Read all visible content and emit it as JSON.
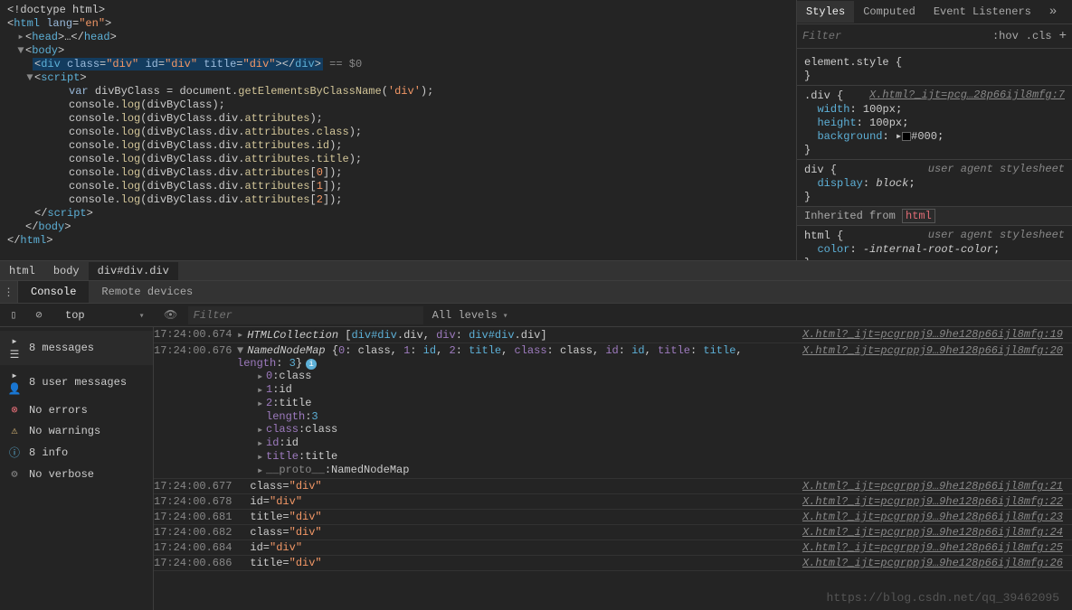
{
  "elements": {
    "doctype": "<!doctype html>",
    "html_open": "html",
    "lang_attr": "lang",
    "lang_val": "\"en\"",
    "head": "head",
    "body": "body",
    "div_line": {
      "tag": "div",
      "class_attr": "class",
      "class_val": "\"div\"",
      "id_attr": "id",
      "id_val": "\"div\"",
      "title_attr": "title",
      "title_val": "\"div\"",
      "eq": "== $0"
    },
    "script": "script",
    "code": [
      "var divByClass = document.getElementsByClassName('div');",
      "console.log(divByClass);",
      "console.log(divByClass.div.attributes);",
      "console.log(divByClass.div.attributes.class);",
      "console.log(divByClass.div.attributes.id);",
      "console.log(divByClass.div.attributes.title);",
      "console.log(divByClass.div.attributes[0]);",
      "console.log(divByClass.div.attributes[1]);",
      "console.log(divByClass.div.attributes[2]);"
    ]
  },
  "styles": {
    "tabs": {
      "styles": "Styles",
      "computed": "Computed",
      "listeners": "Event Listeners"
    },
    "filter_placeholder": "Filter",
    "hov": ":hov",
    "cls": ".cls",
    "element_style": "element.style {",
    "div_sel": ".div {",
    "div_src": "X.html?_ijt=pcg…28p66ijl8mfg:7",
    "width": {
      "name": "width",
      "val": "100px"
    },
    "height": {
      "name": "height",
      "val": "100px"
    },
    "background": {
      "name": "background",
      "val": "#000"
    },
    "div_ua_sel": "div {",
    "ua": "user agent stylesheet",
    "display": {
      "name": "display",
      "val": "block"
    },
    "inherited": "Inherited from",
    "inherited_tag": "html",
    "html_sel": "html {",
    "color": {
      "name": "color",
      "val": "-internal-root-color"
    }
  },
  "breadcrumb": {
    "html": "html",
    "body": "body",
    "current": "div#div.div"
  },
  "console_tabs": {
    "console": "Console",
    "remote": "Remote devices"
  },
  "console_toolbar": {
    "context": "top",
    "filter_placeholder": "Filter",
    "levels": "All levels"
  },
  "sidebar": {
    "messages": "8 messages",
    "user": "8 user messages",
    "errors": "No errors",
    "warnings": "No warnings",
    "info": "8 info",
    "verbose": "No verbose"
  },
  "logs": [
    {
      "ts": "17:24:00.674",
      "type": "htmlcollection",
      "src": "X.html?_ijt=pcgrppj9…9he128p66ijl8mfg:19"
    },
    {
      "ts": "17:24:00.676",
      "type": "namednodemap",
      "src": "X.html?_ijt=pcgrppj9…9he128p66ijl8mfg:20",
      "items": [
        {
          "k": "0",
          "v": "class"
        },
        {
          "k": "1",
          "v": "id"
        },
        {
          "k": "2",
          "v": "title"
        },
        {
          "k": "length",
          "v": "3"
        },
        {
          "k": "class",
          "v": "class"
        },
        {
          "k": "id",
          "v": "id"
        },
        {
          "k": "title",
          "v": "title"
        },
        {
          "proto": "__proto__",
          "v": "NamedNodeMap"
        }
      ]
    },
    {
      "ts": "17:24:00.677",
      "attr": "class=\"div\"",
      "src": "X.html?_ijt=pcgrppj9…9he128p66ijl8mfg:21"
    },
    {
      "ts": "17:24:00.678",
      "attr": "id=\"div\"",
      "src": "X.html?_ijt=pcgrppj9…9he128p66ijl8mfg:22"
    },
    {
      "ts": "17:24:00.681",
      "attr": "title=\"div\"",
      "src": "X.html?_ijt=pcgrppj9…9he128p66ijl8mfg:23"
    },
    {
      "ts": "17:24:00.682",
      "attr": "class=\"div\"",
      "src": "X.html?_ijt=pcgrppj9…9he128p66ijl8mfg:24"
    },
    {
      "ts": "17:24:00.684",
      "attr": "id=\"div\"",
      "src": "X.html?_ijt=pcgrppj9…9he128p66ijl8mfg:25"
    },
    {
      "ts": "17:24:00.686",
      "attr": "title=\"div\"",
      "src": "X.html?_ijt=pcgrppj9…9he128p66ijl8mfg:26"
    }
  ],
  "watermark": "https://blog.csdn.net/qq_39462095",
  "namednodemap_summary": "NamedNodeMap {0: class, 1: id, 2: title, class: class, id: id, title: title, length: 3}",
  "htmlcollection_summary": "HTMLCollection [div#div.div, div: div#div.div]"
}
